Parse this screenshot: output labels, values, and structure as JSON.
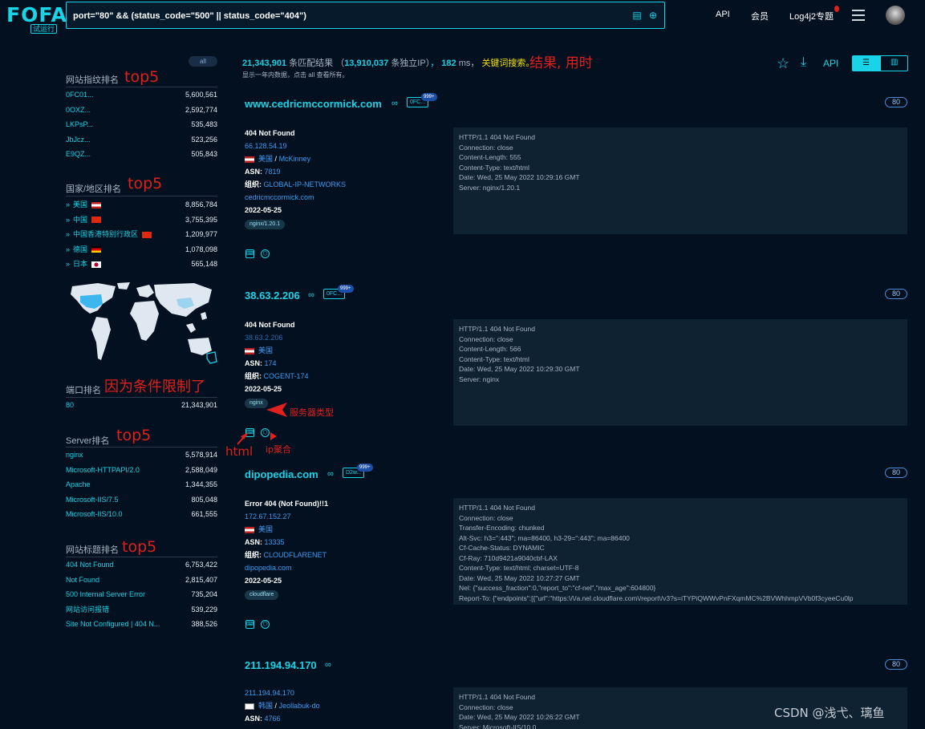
{
  "header": {
    "logo": "FOFA",
    "logo_badge": "试运行",
    "query": "port=\"80\" && (status_code=\"500\" || status_code=\"404\")",
    "nav": [
      "API",
      "会员",
      "Log4j2专题"
    ]
  },
  "sidebar": {
    "all_label": "all",
    "fingerprint": {
      "title": "网站指纹排名",
      "rows": [
        {
          "k": "0FC01...",
          "v": "5,600,561"
        },
        {
          "k": "0OXZ...",
          "v": "2,592,774"
        },
        {
          "k": "LKPsP...",
          "v": "535,483"
        },
        {
          "k": "JbJcz...",
          "v": "523,256"
        },
        {
          "k": "E9QZ...",
          "v": "505,843"
        }
      ]
    },
    "country": {
      "title": "国家/地区排名",
      "rows": [
        {
          "k": "美国",
          "v": "8,856,784",
          "flag": "us"
        },
        {
          "k": "中国",
          "v": "3,755,395",
          "flag": "cn"
        },
        {
          "k": "中国香港特别行政区",
          "v": "1,209,977",
          "flag": "hk"
        },
        {
          "k": "德国",
          "v": "1,078,098",
          "flag": "de"
        },
        {
          "k": "日本",
          "v": "565,148",
          "flag": "jp"
        }
      ]
    },
    "port": {
      "title": "端口排名",
      "rows": [
        {
          "k": "80",
          "v": "21,343,901"
        }
      ]
    },
    "server": {
      "title": "Server排名",
      "rows": [
        {
          "k": "nginx",
          "v": "5,578,914"
        },
        {
          "k": "Microsoft-HTTPAPI/2.0",
          "v": "2,588,049"
        },
        {
          "k": "Apache",
          "v": "1,344,355"
        },
        {
          "k": "Microsoft-IIS/7.5",
          "v": "805,048"
        },
        {
          "k": "Microsoft-IIS/10.0",
          "v": "661,555"
        }
      ]
    },
    "title_rank": {
      "title": "网站标题排名",
      "rows": [
        {
          "k": "404 Not Found",
          "v": "6,753,422"
        },
        {
          "k": "Not Found",
          "v": "2,815,407"
        },
        {
          "k": "500 Internal Server Error",
          "v": "735,204"
        },
        {
          "k": "网站访问报错",
          "v": "539,229"
        },
        {
          "k": "Site Not Configured | 404 N...",
          "v": "388,526"
        }
      ]
    }
  },
  "summary": {
    "count": "21,343,901",
    "count_label": "条匹配结果",
    "ip_prefix": "（",
    "ip_count": "13,910,037",
    "ip_label": "条独立IP）",
    "ms": "182",
    "ms_label": "ms，",
    "keyword_label": "关键词搜索。",
    "sub": "显示一年内数据，点击 all 查看所有。",
    "api_label": "API"
  },
  "annotations": {
    "result_time": "结果, 用时",
    "top5_a": "top5",
    "top5_b": "top5",
    "port_note": "因为条件限制了",
    "top5_c": "top5",
    "top5_d": "top5",
    "server_type": "服务器类型",
    "html": "html",
    "ip_agg": "ip聚合"
  },
  "results": [
    {
      "host": "www.cedricmccormick.com",
      "chip": "0FC...",
      "chip_count": "999+",
      "port": "80",
      "title": "404 Not Found",
      "ip": "66.128.54.19",
      "country": "美国",
      "city": "McKinney",
      "asn": "7819",
      "org": "GLOBAL-IP-NETWORKS",
      "domain": "cedricmccormick.com",
      "date": "2022-05-25",
      "tag": "nginx/1.20.1",
      "response": [
        "HTTP/1.1 404 Not Found",
        "Connection: close",
        "Content-Length: 555",
        "Content-Type: text/html",
        "Date: Wed, 25 May 2022 10:29:16 GMT",
        "Server: nginx/1.20.1"
      ]
    },
    {
      "host": "38.63.2.206",
      "chip": "0FC...",
      "chip_count": "999+",
      "port": "80",
      "title": "404 Not Found",
      "ip": "38.63.2.206",
      "country": "美国",
      "asn": "174",
      "org": "COGENT-174",
      "date": "2022-05-25",
      "tag": "nginx",
      "response": [
        "HTTP/1.1 404 Not Found",
        "Connection: close",
        "Content-Length: 566",
        "Content-Type: text/html",
        "Date: Wed, 25 May 2022 10:29:30 GMT",
        "Server: nginx"
      ]
    },
    {
      "host": "dipopedia.com",
      "chip": "D2w...",
      "chip_count": "999+",
      "port": "80",
      "title": "Error 404 (Not Found)!!1",
      "ip": "172.67.152.27",
      "country": "美国",
      "asn": "13335",
      "org": "CLOUDFLARENET",
      "domain": "dipopedia.com",
      "date": "2022-05-25",
      "tag": "cloudflare",
      "response": [
        "HTTP/1.1 404 Not Found",
        "Connection: close",
        "Transfer-Encoding: chunked",
        "Alt-Svc: h3=\":443\"; ma=86400, h3-29=\":443\"; ma=86400",
        "Cf-Cache-Status: DYNAMIC",
        "Cf-Ray: 710d9421a9040cbf-LAX",
        "Content-Type: text/html; charset=UTF-8",
        "Date: Wed, 25 May 2022 10:27:27 GMT",
        "Nel: {\"success_fraction\":0,\"report_to\":\"cf-nel\",\"max_age\":604800}",
        "Report-To: {\"endpoints\":[{\"url\":\"https:\\/\\/a.nel.cloudflare.com\\/report\\/v3?s=iTYPiQWWvPnFXqmMC%2BVWhhmpVVb0f3cyeeCu0lp"
      ]
    },
    {
      "host": "211.194.94.170",
      "port": "80",
      "ip": "211.194.94.170",
      "country": "韩国",
      "city": "Jeollabuk-do",
      "asn": "4766",
      "response": [
        "HTTP/1.1 404 Not Found",
        "Connection: close",
        "Date: Wed, 25 May 2022 10:26:22 GMT",
        "Server: Microsoft-IIS/10.0"
      ]
    }
  ],
  "labels": {
    "asn": "ASN:",
    "org": "组织:",
    "slash": "/"
  },
  "watermark": "CSDN @浅弋、璃鱼",
  "colors": {
    "accent": "#19d3e6",
    "bg": "#03101f",
    "link": "#3d9bf2",
    "annotation": "#e0201c"
  }
}
